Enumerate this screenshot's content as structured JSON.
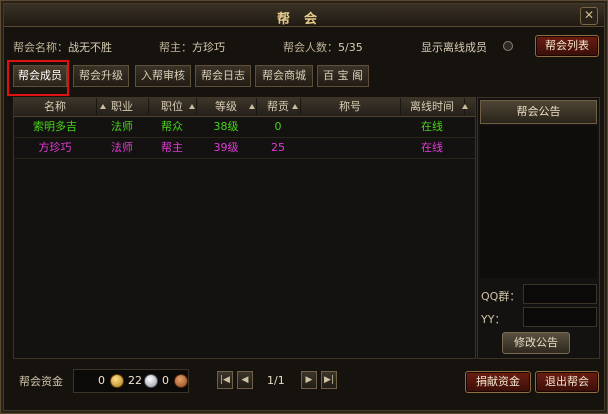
{
  "window": {
    "title": "帮会",
    "close_icon": "✕"
  },
  "info": {
    "guild_name_label": "帮会名称：",
    "guild_name": "战无不胜",
    "leader_label": "帮主：",
    "leader": "方珍巧",
    "members_label": "帮会人数：",
    "members": "5/35",
    "show_offline_label": "显示离线成员",
    "guild_list_button": "帮会列表"
  },
  "tabs": [
    {
      "label": "帮会成员",
      "active": true
    },
    {
      "label": "帮会升级"
    },
    {
      "label": "入帮审核"
    },
    {
      "label": "帮会日志"
    },
    {
      "label": "帮会商城"
    },
    {
      "label": "百 宝 阁"
    }
  ],
  "table": {
    "columns": [
      "名称",
      "职业",
      "职位",
      "等级",
      "帮贡",
      "称号",
      "离线时间"
    ],
    "rows": [
      {
        "name": "索明多吉",
        "class": "法师",
        "position": "帮众",
        "level": "38级",
        "contrib": "0",
        "title": "",
        "offline": "在线",
        "color": "#46d41c"
      },
      {
        "name": "方珍巧",
        "class": "法师",
        "position": "帮主",
        "level": "39级",
        "contrib": "25",
        "title": "",
        "offline": "在线",
        "color": "#e33ad9"
      }
    ]
  },
  "side": {
    "header": "帮会公告",
    "qq_label": "QQ群：",
    "yy_label": "YY：",
    "edit_button": "修改公告"
  },
  "footer": {
    "funds_label": "帮会资金",
    "gold": "0",
    "silver": "22",
    "copper": "0",
    "page": "1/1",
    "donate_button": "捐献资金",
    "leave_button": "退出帮会"
  }
}
